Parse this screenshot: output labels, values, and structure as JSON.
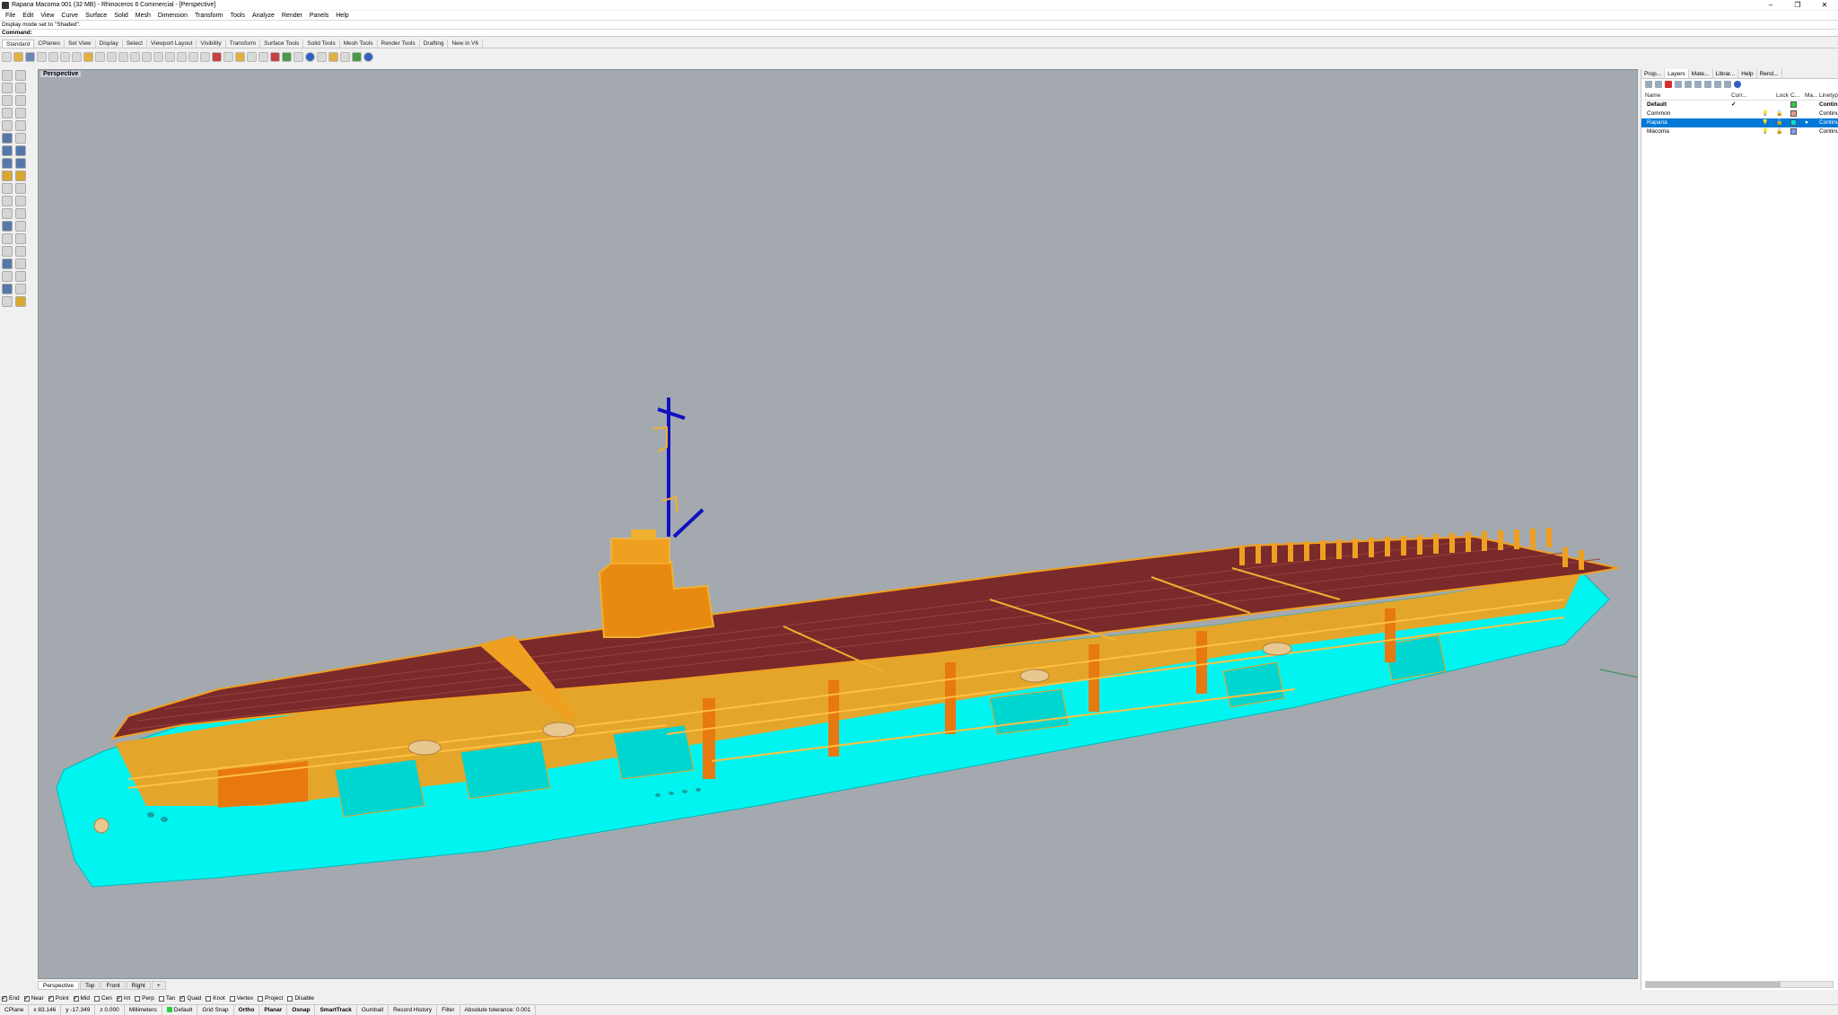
{
  "window": {
    "title": "Rapana Macoma 001 (32 MB) - Rhinoceros 6 Commercial - [Perspective]"
  },
  "menu": [
    "File",
    "Edit",
    "View",
    "Curve",
    "Surface",
    "Solid",
    "Mesh",
    "Dimension",
    "Transform",
    "Tools",
    "Analyze",
    "Render",
    "Panels",
    "Help"
  ],
  "command_history": "Display mode set to \"Shaded\".",
  "command_prompt": "Command:",
  "toolbar_tabs": [
    "Standard",
    "CPlanes",
    "Set View",
    "Display",
    "Select",
    "Viewport Layout",
    "Visibility",
    "Transform",
    "Surface Tools",
    "Solid Tools",
    "Mesh Tools",
    "Render Tools",
    "Drafting",
    "New in V6"
  ],
  "viewport": {
    "label": "Perspective",
    "background": "#a3a9af"
  },
  "viewport_tabs": [
    "Perspective",
    "Top",
    "Front",
    "Right",
    "+"
  ],
  "osnaps": [
    {
      "label": "End",
      "on": true
    },
    {
      "label": "Near",
      "on": true
    },
    {
      "label": "Point",
      "on": true
    },
    {
      "label": "Mid",
      "on": true
    },
    {
      "label": "Cen",
      "on": false
    },
    {
      "label": "Int",
      "on": true
    },
    {
      "label": "Perp",
      "on": false
    },
    {
      "label": "Tan",
      "on": false
    },
    {
      "label": "Quad",
      "on": true
    },
    {
      "label": "Knot",
      "on": false
    },
    {
      "label": "Vertex",
      "on": false
    },
    {
      "label": "Project",
      "on": false
    },
    {
      "label": "Disable",
      "on": false
    }
  ],
  "status": {
    "cplane": "CPlane",
    "x": "x 83.146",
    "y": "y -17.349",
    "z": "z 0.000",
    "units": "Millimeters",
    "layer": "Default",
    "grid_snap": "Grid Snap",
    "ortho": "Ortho",
    "planar": "Planar",
    "osnap": "Osnap",
    "smarttrack": "SmartTrack",
    "gumball": "Gumball",
    "record_history": "Record History",
    "filter": "Filter",
    "tolerance": "Absolute tolerance: 0.001"
  },
  "panel": {
    "tabs": [
      "Prop...",
      "Layers",
      "Mate...",
      "Librar...",
      "Help",
      "Rend..."
    ],
    "active_tab": "Layers",
    "columns": [
      "Name",
      "Curr...",
      "Lock",
      "C...",
      "Ma...",
      "Linetype"
    ],
    "layers": [
      {
        "name": "Default",
        "current": "✓",
        "color": "#2ecc40",
        "linetype": "Continuous",
        "bold": true,
        "selected": false
      },
      {
        "name": "Common",
        "current": "",
        "color": "#e0a080",
        "linetype": "Continuous",
        "bold": false,
        "selected": false
      },
      {
        "name": "Rapana",
        "current": "",
        "color": "#00e0e0",
        "linetype": "Continuous",
        "bold": false,
        "selected": true
      },
      {
        "name": "Macoma",
        "current": "",
        "color": "#8899ee",
        "linetype": "Continuous",
        "bold": false,
        "selected": false
      }
    ]
  },
  "colors": {
    "hull": "#00f5f0",
    "deck": "#7a2a2a",
    "structure": "#f0a020",
    "island": "#e88a10",
    "mast": "#1010c0"
  }
}
